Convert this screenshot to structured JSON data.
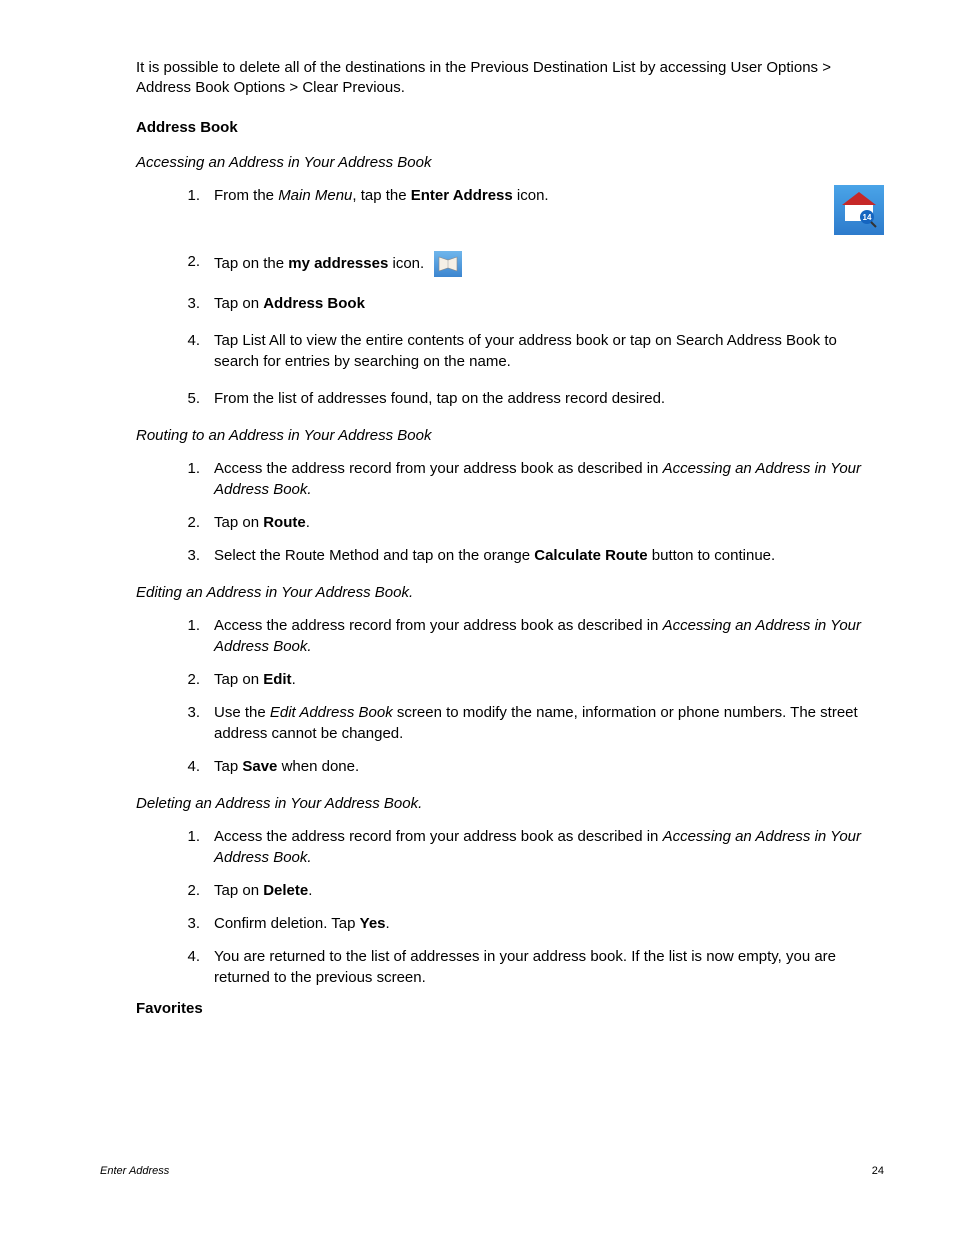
{
  "intro": "It is possible to delete all of the destinations in the Previous Destination List by accessing User Options > Address Book Options > Clear Previous.",
  "heading_address_book": "Address Book",
  "sub_accessing": "Accessing an Address in Your Address Book",
  "accessing": {
    "s1_a": "From the ",
    "s1_b": "Main Menu",
    "s1_c": ", tap the ",
    "s1_d": "Enter Address",
    "s1_e": " icon.",
    "s2_a": "Tap on the ",
    "s2_b": "my addresses",
    "s2_c": " icon.",
    "s3_a": "Tap on ",
    "s3_b": "Address Book",
    "s4": "Tap List All to view the entire contents of your address book or tap on Search Address Book to search for entries by searching on the name.",
    "s5": "From the list of addresses found, tap on the address record desired."
  },
  "sub_routing": "Routing to an Address in Your Address Book",
  "routing": {
    "s1_a": "Access the address record from your address book as described in ",
    "s1_b": "Accessing an Address in Your Address Book.",
    "s2_a": "Tap on ",
    "s2_b": "Route",
    "s2_c": ".",
    "s3_a": "Select the Route Method and tap on the orange ",
    "s3_b": "Calculate Route",
    "s3_c": " button to continue."
  },
  "sub_editing": "Editing an Address in Your Address Book.",
  "editing": {
    "s1_a": "Access the address record from your address book as described in ",
    "s1_b": "Accessing an Address in Your Address Book.",
    "s2_a": "Tap on ",
    "s2_b": "Edit",
    "s2_c": ".",
    "s3_a": "Use the ",
    "s3_b": "Edit Address Book",
    "s3_c": " screen to modify the name, information or phone numbers.  The street address cannot be changed.",
    "s4_a": "Tap ",
    "s4_b": "Save",
    "s4_c": " when done."
  },
  "sub_deleting": "Deleting an Address in Your Address Book.",
  "deleting": {
    "s1_a": "Access the address record from your address book as described in ",
    "s1_b": "Accessing an Address in Your Address Book.",
    "s2_a": "Tap on ",
    "s2_b": "Delete",
    "s2_c": ".",
    "s3_a": "Confirm deletion.  Tap ",
    "s3_b": "Yes",
    "s3_c": ".",
    "s4": "You are returned to the list of addresses in your address book.  If the list is now empty, you are returned to the previous screen."
  },
  "heading_favorites": "Favorites",
  "footer_left": "Enter Address",
  "footer_right": "24",
  "n1": "1.",
  "n2": "2.",
  "n3": "3.",
  "n4": "4.",
  "n5": "5."
}
